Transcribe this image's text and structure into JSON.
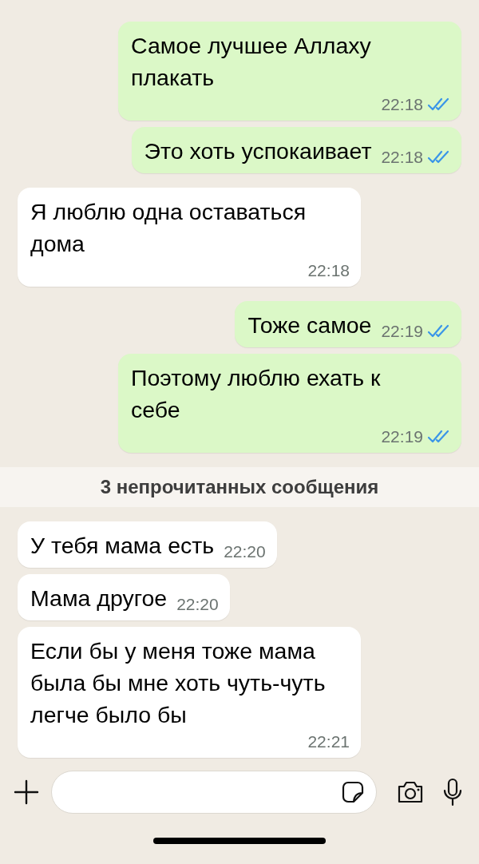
{
  "chat": [
    {
      "kind": "message",
      "outgoing": true,
      "text": "Самое лучшее Аллаху плакать",
      "time": "22:18",
      "read": true
    },
    {
      "kind": "message",
      "outgoing": true,
      "text": "Это хоть успокаивает",
      "time": "22:18",
      "read": true
    },
    {
      "kind": "message",
      "outgoing": false,
      "text": "Я люблю одна оставаться дома",
      "time": "22:18"
    },
    {
      "kind": "message",
      "outgoing": true,
      "text": "Тоже самое",
      "time": "22:19",
      "read": true
    },
    {
      "kind": "message",
      "outgoing": true,
      "text": "Поэтому люблю ехать к себе",
      "time": "22:19",
      "read": true
    },
    {
      "kind": "unread",
      "text": "3 непрочитанных сообщения"
    },
    {
      "kind": "message",
      "outgoing": false,
      "text": "У тебя мама есть",
      "time": "22:20"
    },
    {
      "kind": "message",
      "outgoing": false,
      "text": "Мама другое",
      "time": "22:20"
    },
    {
      "kind": "message",
      "outgoing": false,
      "text": "Если бы у меня тоже мама была бы мне хоть чуть-чуть легче было бы",
      "time": "22:21"
    }
  ]
}
